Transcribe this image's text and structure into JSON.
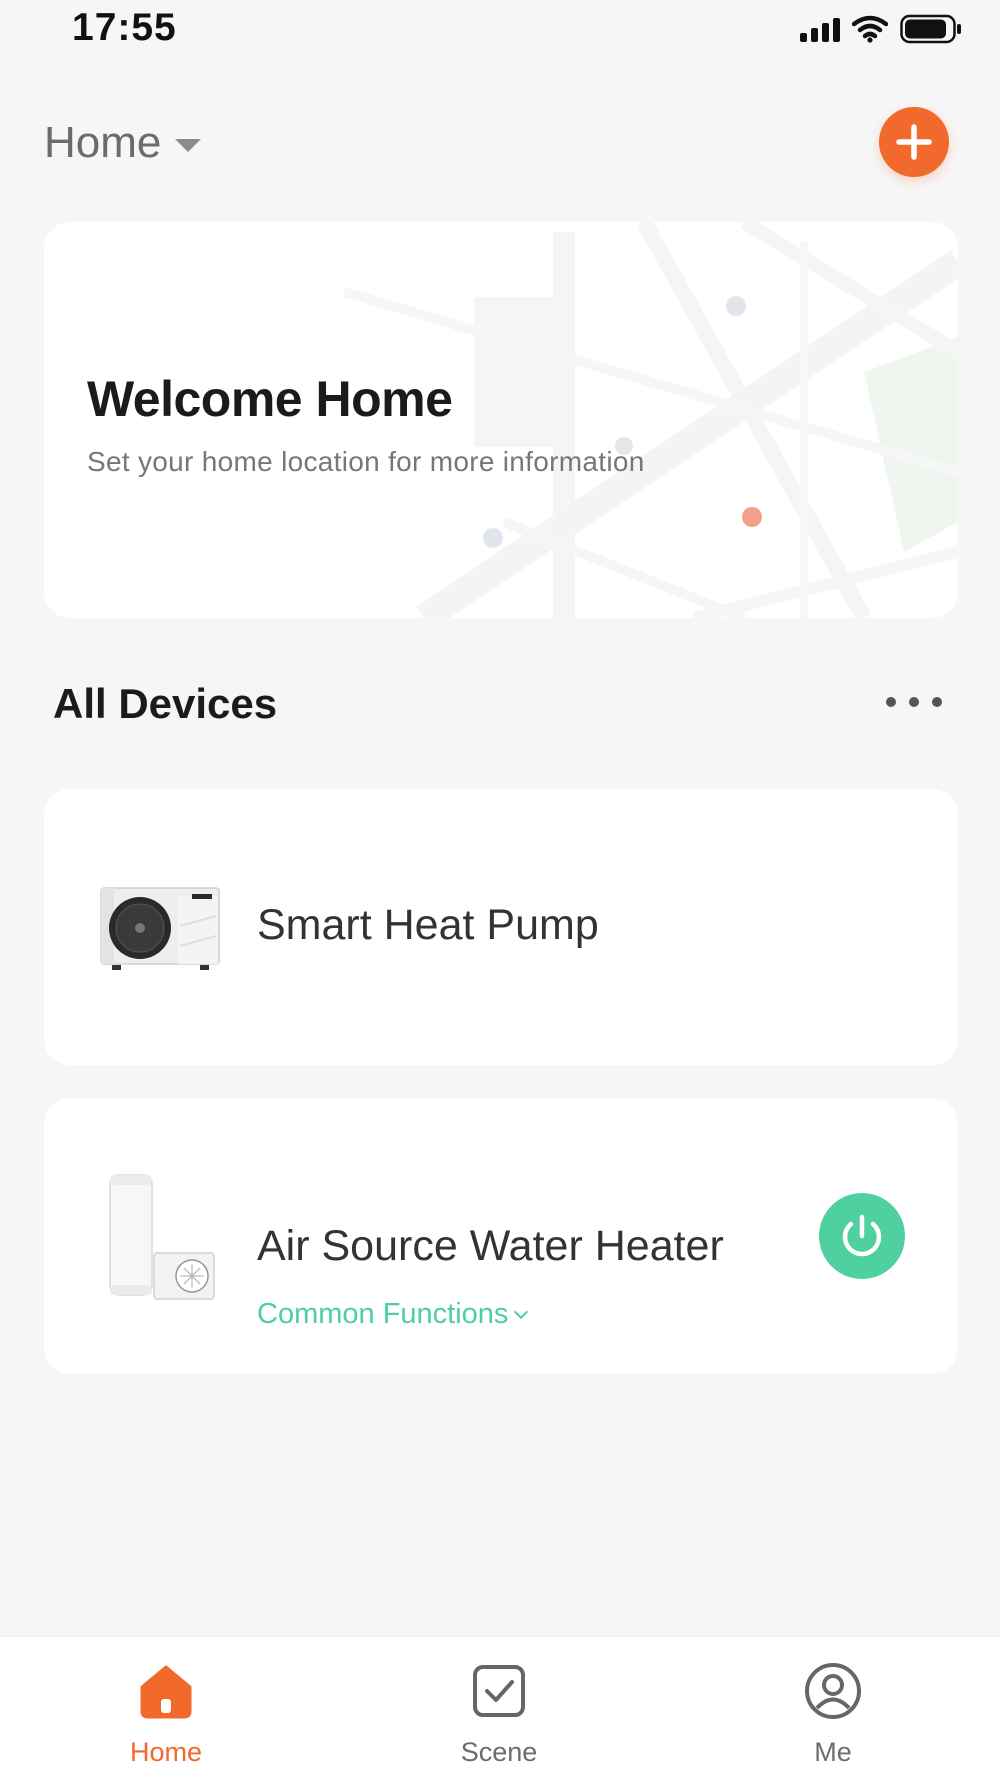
{
  "status_bar": {
    "time": "17:55",
    "icons": [
      "cellular-signal-icon",
      "wifi-icon",
      "battery-icon"
    ]
  },
  "header": {
    "home_label": "Home",
    "add_icon": "plus-icon"
  },
  "welcome_card": {
    "title": "Welcome Home",
    "subtitle": "Set your home location for more information"
  },
  "devices_section": {
    "title": "All Devices",
    "more_icon": "ellipsis-icon"
  },
  "devices": [
    {
      "name": "Smart Heat Pump",
      "icon": "heat-pump-icon"
    },
    {
      "name": "Air Source Water Heater",
      "icon": "water-heater-icon",
      "functions_label": "Common Functions",
      "power_icon": "power-icon"
    }
  ],
  "tab_bar": {
    "tabs": [
      {
        "label": "Home",
        "icon": "home-icon",
        "active": true
      },
      {
        "label": "Scene",
        "icon": "scene-check-icon",
        "active": false
      },
      {
        "label": "Me",
        "icon": "user-icon",
        "active": false
      }
    ]
  },
  "colors": {
    "accent": "#f26a2b",
    "green": "#4fd0a1",
    "background": "#f6f6f6",
    "card": "#ffffff"
  }
}
